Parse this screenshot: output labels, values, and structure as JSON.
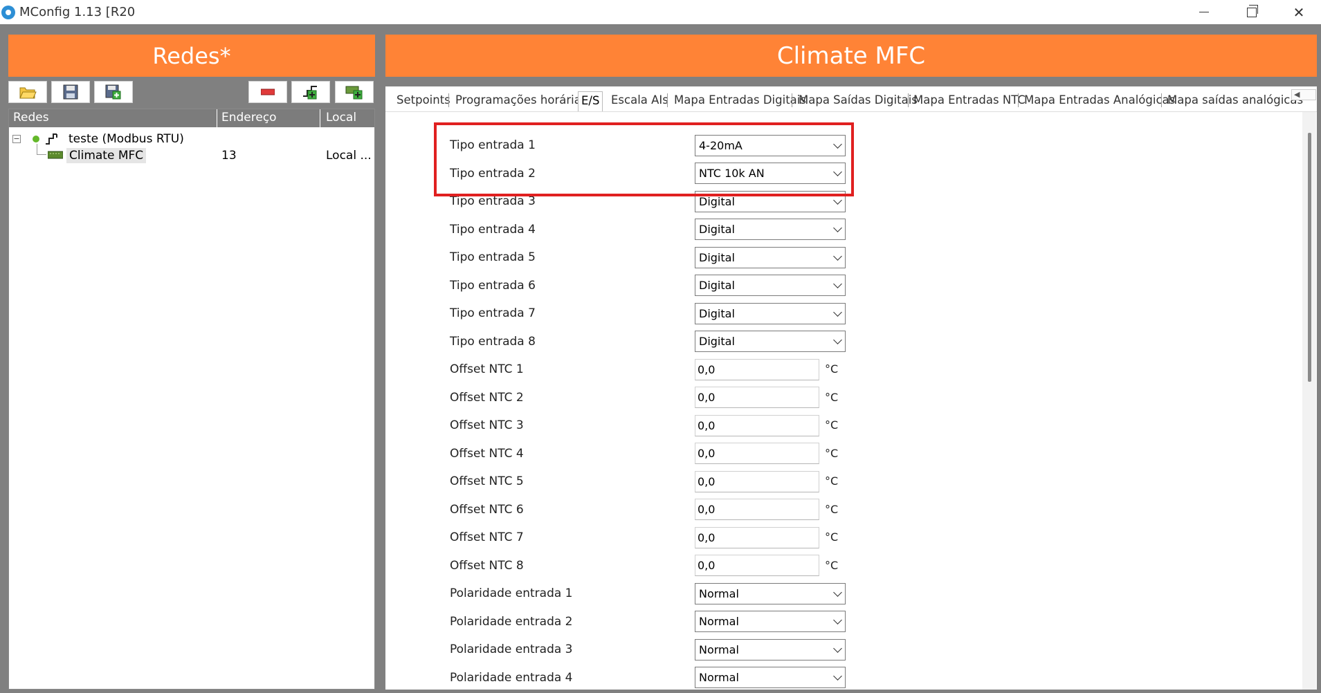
{
  "window": {
    "title": "MConfig 1.13 [R20",
    "minimize_glyph": "—",
    "close_glyph": "✕"
  },
  "left": {
    "header": "Redes*",
    "toolbar_icons": [
      "open-folder-icon",
      "save-icon",
      "save-as-icon",
      "remove-icon",
      "add-network-icon",
      "add-device-icon"
    ],
    "columns": [
      "Redes",
      "Endereço",
      "Local"
    ],
    "tree": {
      "network_label": "teste (Modbus RTU)",
      "expander": "−",
      "device_label": "Climate MFC",
      "device_address": "13",
      "device_local": "Local ..."
    }
  },
  "right": {
    "header": "Climate MFC",
    "tabs": [
      "Setpoints",
      "Programações horárias",
      "E/S",
      "Escala AIs",
      "Mapa Entradas Digitais",
      "Mapa Saídas Digitais",
      "Mapa Entradas NTC",
      "Mapa Entradas Analógicas",
      "Mapa saídas analógicas"
    ],
    "active_tab": "E/S",
    "tabs_scroll_glyph": "◀",
    "fields": {
      "tipo1": {
        "label": "Tipo entrada 1",
        "value": "4-20mA"
      },
      "tipo2": {
        "label": "Tipo entrada 2",
        "value": "NTC 10k AN"
      },
      "tipo3": {
        "label": "Tipo entrada 3",
        "value": "Digital"
      },
      "tipo4": {
        "label": "Tipo entrada 4",
        "value": "Digital"
      },
      "tipo5": {
        "label": "Tipo entrada 5",
        "value": "Digital"
      },
      "tipo6": {
        "label": "Tipo entrada 6",
        "value": "Digital"
      },
      "tipo7": {
        "label": "Tipo entrada 7",
        "value": "Digital"
      },
      "tipo8": {
        "label": "Tipo entrada 8",
        "value": "Digital"
      },
      "offset1": {
        "label": "Offset NTC 1",
        "value": "0,0",
        "unit": "°C"
      },
      "offset2": {
        "label": "Offset NTC 2",
        "value": "0,0",
        "unit": "°C"
      },
      "offset3": {
        "label": "Offset NTC 3",
        "value": "0,0",
        "unit": "°C"
      },
      "offset4": {
        "label": "Offset NTC 4",
        "value": "0,0",
        "unit": "°C"
      },
      "offset5": {
        "label": "Offset NTC 5",
        "value": "0,0",
        "unit": "°C"
      },
      "offset6": {
        "label": "Offset NTC 6",
        "value": "0,0",
        "unit": "°C"
      },
      "offset7": {
        "label": "Offset NTC 7",
        "value": "0,0",
        "unit": "°C"
      },
      "offset8": {
        "label": "Offset NTC 8",
        "value": "0,0",
        "unit": "°C"
      },
      "pol1": {
        "label": "Polaridade entrada 1",
        "value": "Normal"
      },
      "pol2": {
        "label": "Polaridade entrada 2",
        "value": "Normal"
      },
      "pol3": {
        "label": "Polaridade entrada 3",
        "value": "Normal"
      },
      "pol4": {
        "label": "Polaridade entrada 4",
        "value": "Normal"
      }
    }
  },
  "colors": {
    "accent": "#ff8336",
    "highlight": "#e02020",
    "workspace": "#808080"
  }
}
